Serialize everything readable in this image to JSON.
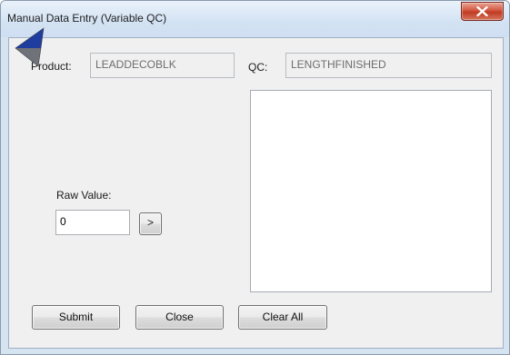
{
  "window": {
    "title": "Manual Data Entry (Variable QC)"
  },
  "icons": {
    "close": "close-x-icon",
    "next": "chevron-right-icon",
    "pointer": "mouse-pointer-icon"
  },
  "colors": {
    "close_button": "#c94a33",
    "window_frame": "#d6e3f1",
    "pointer": "#1f3d9e"
  },
  "form": {
    "product_label": "Product:",
    "product_value": "LEADDECOBLK",
    "qc_label": "QC:",
    "qc_value": "LENGTHFINISHED",
    "raw_value_label": "Raw Value:",
    "raw_value": "0",
    "next_button_label": ">"
  },
  "buttons": {
    "submit": "Submit",
    "close": "Close",
    "clear_all": "Clear All"
  }
}
